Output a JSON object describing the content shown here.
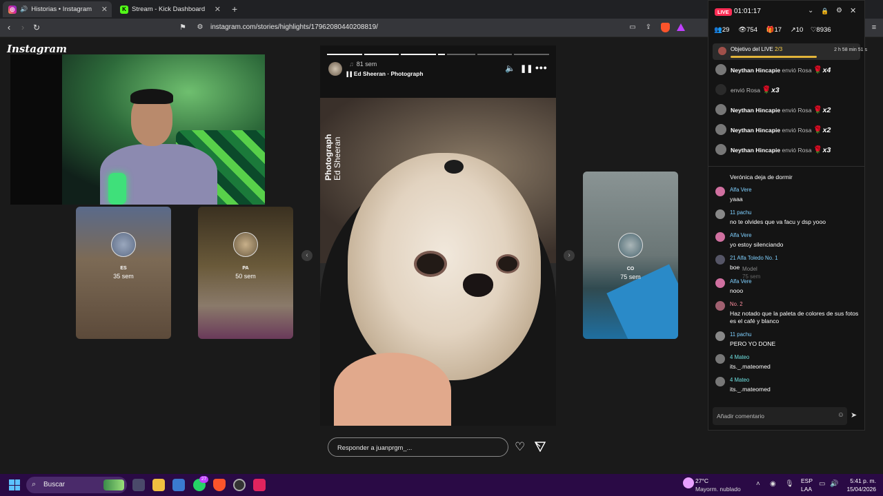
{
  "tabs": [
    {
      "label": "Historias • Instagram",
      "active": true
    },
    {
      "label": "Stream - Kick Dashboard",
      "active": false
    }
  ],
  "new_tab": "+",
  "address": {
    "url": "instagram.com/stories/highlights/17962080440208819/"
  },
  "instagram": {
    "logo": "Instagram",
    "side_cards": [
      {
        "code": "ES",
        "age": "35 sem"
      },
      {
        "code": "PA",
        "age": "50 sem"
      },
      {
        "code": "CO",
        "age": "75 sem"
      }
    ],
    "story": {
      "age": "81 sem",
      "song": "Ed Sheeran · Photograph",
      "overlay_title": "Photograph",
      "overlay_artist": "Ed Sheeran",
      "reply_placeholder": "Responder a juanprgm_..."
    }
  },
  "live": {
    "badge": "LIVE",
    "timer": "01:01:17",
    "stats": {
      "viewers_a": "29",
      "views": "754",
      "gifts": "17",
      "shares": "10",
      "likes": "8936"
    },
    "goal": {
      "label": "Objetivo del LIVE",
      "count": "2/3",
      "time_left": "2 h 58 min 51 s",
      "progress": 0.67
    },
    "gifts": [
      {
        "user": "Neythan Hincapie",
        "action": "envió Rosa",
        "mult": "x4"
      },
      {
        "user": "",
        "action": "envió Rosa",
        "mult": "x3"
      },
      {
        "user": "Neythan Hincapie",
        "action": "envió Rosa",
        "mult": "x2"
      },
      {
        "user": "Neythan Hincapie",
        "action": "envió Rosa",
        "mult": "x2"
      },
      {
        "user": "Neythan Hincapie",
        "action": "envió Rosa",
        "mult": "x3"
      }
    ],
    "chat": [
      {
        "msg": "Verónica deja de dormir",
        "meta": "",
        "avatar": "#c05070"
      },
      {
        "msg": "yaaa",
        "meta": "Alfa  Vere",
        "avatar": "#d070a0"
      },
      {
        "msg": "no te olvides que va facu y dsp yooo",
        "meta": "11  pachu",
        "avatar": "#888"
      },
      {
        "msg": "yo estoy silenciando",
        "meta": "Alfa  Vere",
        "avatar": "#d070a0"
      },
      {
        "msg": "boe",
        "meta": "21  Alfa  Toledo  No. 1",
        "avatar": "#556"
      },
      {
        "msg": "nooo",
        "meta": "Alfa  Vere",
        "avatar": "#d070a0"
      },
      {
        "msg": "Haz notado que la paleta de colores de sus fotos es el café y blanco",
        "meta": "No. 2",
        "avatar": "#a06070"
      },
      {
        "msg": "PERO YO DONE",
        "meta": "11  pachu",
        "avatar": "#888"
      },
      {
        "msg": "its._.mateomed",
        "meta": "4  Mateo",
        "avatar": "#777"
      },
      {
        "msg": "its._.mateomed",
        "meta": "4  Mateo",
        "avatar": "#777"
      }
    ],
    "overlay_name": "Model",
    "overlay_age": "75 sem",
    "comment_placeholder": "Añadir comentario"
  },
  "taskbar": {
    "search": "Buscar",
    "weather_temp": "27°C",
    "weather_desc": "Mayorm. nublado",
    "lang": "ESP",
    "lang2": "LAA",
    "time": "5:41 p. m.",
    "date": "15/04/2026",
    "whatsapp_count": "27"
  }
}
